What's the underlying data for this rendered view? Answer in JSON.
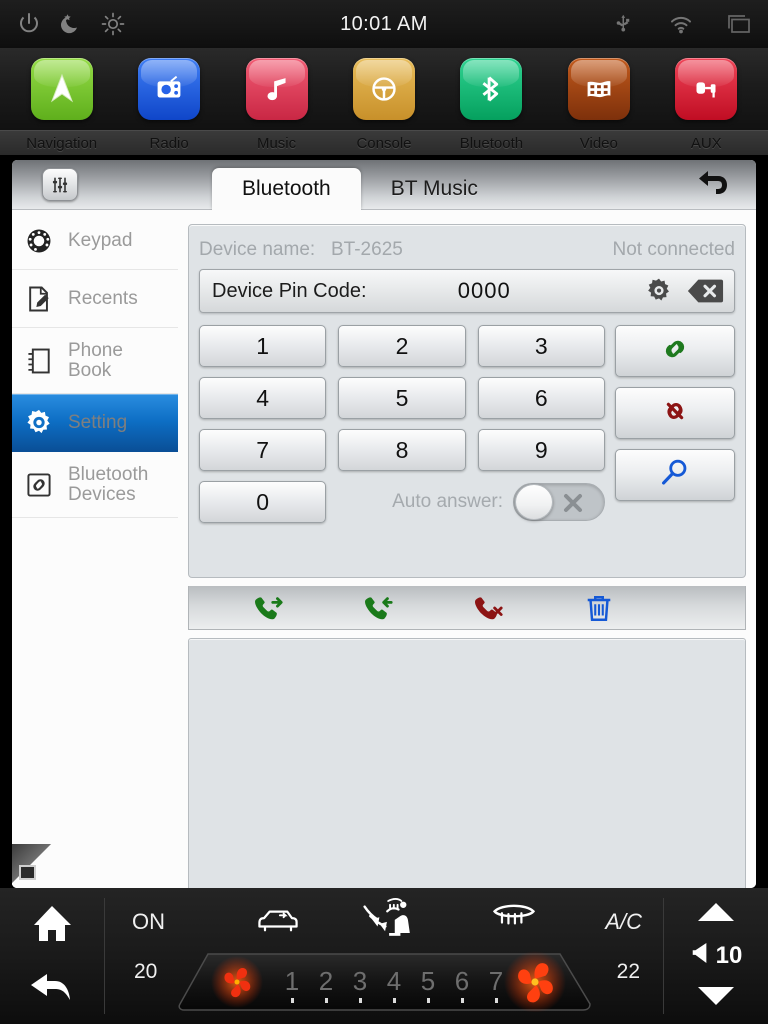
{
  "statusbar": {
    "clock": "10:01 AM",
    "left_icons": [
      "power-icon",
      "night-mode-icon",
      "brightness-icon"
    ],
    "right_icons": [
      "usb-icon",
      "wifi-icon",
      "multiwindow-icon"
    ]
  },
  "dock": {
    "apps": [
      {
        "label": "Navigation",
        "icon": "navigation-arrow-icon",
        "color": "#7dc832"
      },
      {
        "label": "Radio",
        "icon": "radio-icon",
        "color": "#1f5fe0"
      },
      {
        "label": "Music",
        "icon": "music-note-icon",
        "color": "#e0435a"
      },
      {
        "label": "Console",
        "icon": "steering-wheel-icon",
        "color": "#d9a52e"
      },
      {
        "label": "Bluetooth",
        "icon": "bluetooth-icon",
        "color": "#12b572"
      },
      {
        "label": "Video",
        "icon": "film-strip-icon",
        "color": "#9c4414"
      },
      {
        "label": "AUX",
        "icon": "aux-cable-icon",
        "color": "#d9263a"
      }
    ]
  },
  "panel": {
    "eq_button": "equalizer-icon",
    "back_button": "back-arrow-icon",
    "tabs": [
      {
        "label": "Bluetooth",
        "active": true
      },
      {
        "label": "BT Music",
        "active": false
      }
    ]
  },
  "sidebar": {
    "items": [
      {
        "label": "Keypad",
        "icon": "dialpad-icon",
        "active": false
      },
      {
        "label": "Recents",
        "icon": "recents-icon",
        "active": false
      },
      {
        "label": "Phone\nBook",
        "icon": "phonebook-icon",
        "active": false
      },
      {
        "label": "Setting",
        "icon": "gear-icon",
        "active": true
      },
      {
        "label": "Bluetooth\nDevices",
        "icon": "link-icon",
        "active": false
      }
    ]
  },
  "bluetooth": {
    "device_name_label": "Device name:",
    "device_name_value": "BT-2625",
    "connection_status": "Not connected",
    "pin_label": "Device Pin Code:",
    "pin_value": "0000",
    "pin_settings_icon": "gear-icon",
    "pin_backspace_icon": "backspace-icon",
    "keys": [
      "1",
      "2",
      "3",
      "4",
      "5",
      "6",
      "7",
      "8",
      "9",
      "0"
    ],
    "auto_answer_label": "Auto answer:",
    "auto_answer_state": "off",
    "auto_answer_glyph": "✕",
    "action_buttons": [
      {
        "name": "pair-button",
        "icon": "link-icon",
        "color": "#1f7a1f"
      },
      {
        "name": "unpair-button",
        "icon": "broken-link-icon",
        "color": "#8c1414"
      },
      {
        "name": "search-button",
        "icon": "search-icon",
        "color": "#1559d6"
      }
    ],
    "call_buttons": [
      {
        "name": "outgoing-calls-button",
        "icon": "outgoing-call-icon",
        "color": "#1a7a1a"
      },
      {
        "name": "incoming-calls-button",
        "icon": "incoming-call-icon",
        "color": "#1a7a1a"
      },
      {
        "name": "missed-calls-button",
        "icon": "missed-call-icon",
        "color": "#8c1414"
      },
      {
        "name": "delete-button",
        "icon": "trash-icon",
        "color": "#1559d6"
      }
    ]
  },
  "climate": {
    "home_icon": "home-icon",
    "back_icon": "back-arrow-icon",
    "power_label": "ON",
    "ac_label": "A/C",
    "recirculation_icon": "car-recirculation-icon",
    "airflow_icon": "airflow-seat-icon",
    "defrost_icon": "rear-defrost-icon",
    "temp_left": "20",
    "temp_right": "22",
    "fan_ticks": [
      "1",
      "2",
      "3",
      "4",
      "5",
      "6",
      "7"
    ],
    "fan_left_icon": "fan-icon",
    "fan_right_icon": "fan-icon",
    "volume_up_icon": "triangle-up-icon",
    "volume_down_icon": "triangle-down-icon",
    "volume_icon": "speaker-icon",
    "volume_value": "10"
  },
  "colors": {
    "accent_blue": "#0d6ec4",
    "panel_bg": "#dfe3e6",
    "dark_bg": "#141414"
  }
}
